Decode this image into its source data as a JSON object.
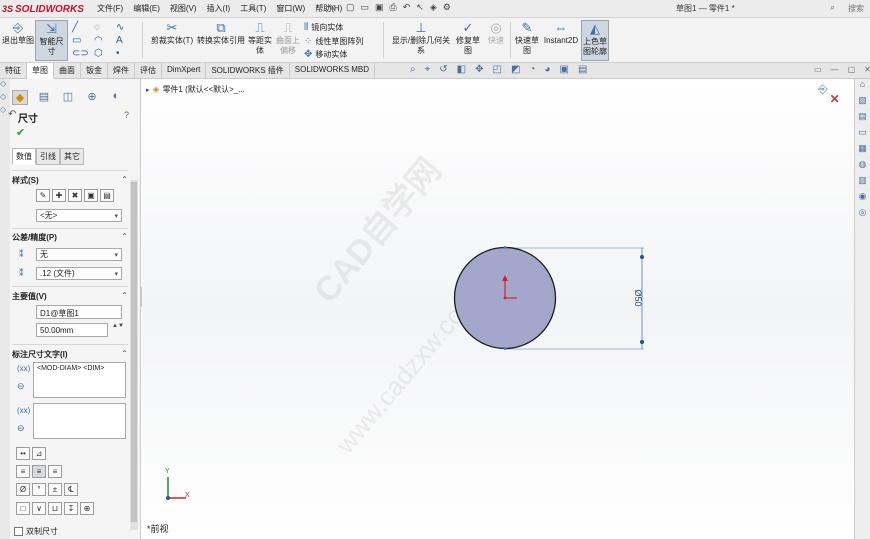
{
  "app": {
    "logo_text": "SOLIDWORKS",
    "logo_prefix": "3S",
    "doc_title": "草图1 — 零件1 *",
    "search_label": "搜索"
  },
  "menu": [
    "文件(F)",
    "编辑(E)",
    "视图(V)",
    "插入(I)",
    "工具(T)",
    "窗口(W)",
    "帮助(H)"
  ],
  "quick_access": [
    "new-icon",
    "open-icon",
    "save-icon",
    "print-icon",
    "undo-icon",
    "select-icon",
    "rebuild-icon",
    "options-icon"
  ],
  "commands": {
    "exit_sketch": "退出草图",
    "smart_dim": "智能尺寸",
    "trim": "剪裁实体(T)",
    "convert": "转换实体引用",
    "offset": "等距实体",
    "surface_offset": "曲面上偏移",
    "mirror": "镜向实体",
    "linear_pattern": "线性草图阵列",
    "move": "移动实体",
    "show_relations": "显示/删除几何关系",
    "repair": "修复草图",
    "quick_snaps": "快速",
    "rapid_sketch": "快速草图",
    "instant2d": "Instant2D",
    "shaded_contours": "上色草图轮廓"
  },
  "tabs": [
    "特征",
    "草图",
    "曲面",
    "钣金",
    "焊件",
    "评估",
    "DimXpert",
    "SOLIDWORKS 插件",
    "SOLIDWORKS MBD"
  ],
  "active_tab": "草图",
  "property_manager": {
    "title": "尺寸",
    "help": "?",
    "ok": "✔",
    "subtabs": [
      "数值",
      "引线",
      "其它"
    ],
    "style": {
      "header": "样式(S)",
      "value": "<无>"
    },
    "tolerance": {
      "header": "公差/精度(P)",
      "tol_value": "无",
      "precision_value": ".12 (文件)"
    },
    "primary": {
      "header": "主要值(V)",
      "name": "D1@草图1",
      "value": "50.00mm",
      "spin": "▲▼"
    },
    "dim_text": {
      "header": "标注尺寸文字(I)",
      "content": "<MOD-DIAM> <DIM>"
    },
    "dual": "双制尺寸"
  },
  "graphics": {
    "tree_label": "零件1 (默认<<默认>_...",
    "view_label": "*前视",
    "triad_x": "X",
    "triad_y": "Y",
    "dim_value_vertical": "Ø50",
    "watermark_1": "CAD自学网",
    "watermark_2": "www.cadzxw.com"
  },
  "colors": {
    "circle_fill": "#a3a7cb",
    "accent": "#3a6fb0",
    "logo": "#c8102e",
    "origin": "#d8202a"
  }
}
